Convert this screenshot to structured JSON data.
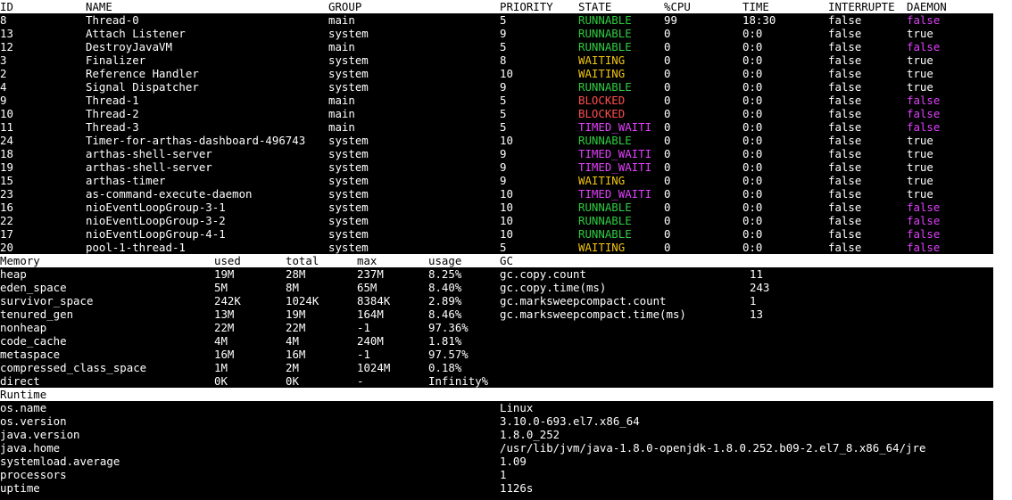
{
  "colors": {
    "background": "#000000",
    "header_bg": "#ffffff",
    "runnable": "#2ecc40",
    "waiting": "#f1c40f",
    "blocked": "#ff4d4d",
    "timed_waiting": "#e040fb",
    "daemon_false": "#e040fb"
  },
  "threads": {
    "headers": [
      "ID",
      "NAME",
      "GROUP",
      "PRIORITY",
      "STATE",
      "%CPU",
      "TIME",
      "INTERRUPTE",
      "DAEMON"
    ],
    "rows": [
      {
        "id": "8",
        "name": "Thread-0",
        "group": "main",
        "priority": "5",
        "state": "RUNNABLE",
        "cpu": "99",
        "time": "18:30",
        "interrupted": "false",
        "daemon": "false"
      },
      {
        "id": "13",
        "name": "Attach Listener",
        "group": "system",
        "priority": "9",
        "state": "RUNNABLE",
        "cpu": "0",
        "time": "0:0",
        "interrupted": "false",
        "daemon": "true"
      },
      {
        "id": "12",
        "name": "DestroyJavaVM",
        "group": "main",
        "priority": "5",
        "state": "RUNNABLE",
        "cpu": "0",
        "time": "0:0",
        "interrupted": "false",
        "daemon": "false"
      },
      {
        "id": "3",
        "name": "Finalizer",
        "group": "system",
        "priority": "8",
        "state": "WAITING",
        "cpu": "0",
        "time": "0:0",
        "interrupted": "false",
        "daemon": "true"
      },
      {
        "id": "2",
        "name": "Reference Handler",
        "group": "system",
        "priority": "10",
        "state": "WAITING",
        "cpu": "0",
        "time": "0:0",
        "interrupted": "false",
        "daemon": "true"
      },
      {
        "id": "4",
        "name": "Signal Dispatcher",
        "group": "system",
        "priority": "9",
        "state": "RUNNABLE",
        "cpu": "0",
        "time": "0:0",
        "interrupted": "false",
        "daemon": "true"
      },
      {
        "id": "9",
        "name": "Thread-1",
        "group": "main",
        "priority": "5",
        "state": "BLOCKED",
        "cpu": "0",
        "time": "0:0",
        "interrupted": "false",
        "daemon": "false"
      },
      {
        "id": "10",
        "name": "Thread-2",
        "group": "main",
        "priority": "5",
        "state": "BLOCKED",
        "cpu": "0",
        "time": "0:0",
        "interrupted": "false",
        "daemon": "false"
      },
      {
        "id": "11",
        "name": "Thread-3",
        "group": "main",
        "priority": "5",
        "state": "TIMED_WAITI",
        "cpu": "0",
        "time": "0:0",
        "interrupted": "false",
        "daemon": "false"
      },
      {
        "id": "24",
        "name": "Timer-for-arthas-dashboard-496743",
        "group": "system",
        "priority": "10",
        "state": "RUNNABLE",
        "cpu": "0",
        "time": "0:0",
        "interrupted": "false",
        "daemon": "true"
      },
      {
        "id": "18",
        "name": "arthas-shell-server",
        "group": "system",
        "priority": "9",
        "state": "TIMED_WAITI",
        "cpu": "0",
        "time": "0:0",
        "interrupted": "false",
        "daemon": "true"
      },
      {
        "id": "19",
        "name": "arthas-shell-server",
        "group": "system",
        "priority": "9",
        "state": "TIMED_WAITI",
        "cpu": "0",
        "time": "0:0",
        "interrupted": "false",
        "daemon": "true"
      },
      {
        "id": "15",
        "name": "arthas-timer",
        "group": "system",
        "priority": "9",
        "state": "WAITING",
        "cpu": "0",
        "time": "0:0",
        "interrupted": "false",
        "daemon": "true"
      },
      {
        "id": "23",
        "name": "as-command-execute-daemon",
        "group": "system",
        "priority": "10",
        "state": "TIMED_WAITI",
        "cpu": "0",
        "time": "0:0",
        "interrupted": "false",
        "daemon": "true"
      },
      {
        "id": "16",
        "name": "nioEventLoopGroup-3-1",
        "group": "system",
        "priority": "10",
        "state": "RUNNABLE",
        "cpu": "0",
        "time": "0:0",
        "interrupted": "false",
        "daemon": "false"
      },
      {
        "id": "22",
        "name": "nioEventLoopGroup-3-2",
        "group": "system",
        "priority": "10",
        "state": "RUNNABLE",
        "cpu": "0",
        "time": "0:0",
        "interrupted": "false",
        "daemon": "false"
      },
      {
        "id": "17",
        "name": "nioEventLoopGroup-4-1",
        "group": "system",
        "priority": "10",
        "state": "RUNNABLE",
        "cpu": "0",
        "time": "0:0",
        "interrupted": "false",
        "daemon": "false"
      },
      {
        "id": "20",
        "name": "pool-1-thread-1",
        "group": "system",
        "priority": "5",
        "state": "WAITING",
        "cpu": "0",
        "time": "0:0",
        "interrupted": "false",
        "daemon": "false"
      }
    ]
  },
  "memory": {
    "headers": [
      "Memory",
      "used",
      "total",
      "max",
      "usage",
      "GC"
    ],
    "rows": [
      {
        "name": "heap",
        "used": "19M",
        "total": "28M",
        "max": "237M",
        "usage": "8.25%",
        "gc_name": "gc.copy.count",
        "gc_value": "11"
      },
      {
        "name": "eden_space",
        "used": "5M",
        "total": "8M",
        "max": "65M",
        "usage": "8.40%",
        "gc_name": "gc.copy.time(ms)",
        "gc_value": "243"
      },
      {
        "name": "survivor_space",
        "used": "242K",
        "total": "1024K",
        "max": "8384K",
        "usage": "2.89%",
        "gc_name": "gc.marksweepcompact.count",
        "gc_value": "1"
      },
      {
        "name": "tenured_gen",
        "used": "13M",
        "total": "19M",
        "max": "164M",
        "usage": "8.46%",
        "gc_name": "gc.marksweepcompact.time(ms)",
        "gc_value": "13"
      },
      {
        "name": "nonheap",
        "used": "22M",
        "total": "22M",
        "max": "-1",
        "usage": "97.36%",
        "gc_name": "",
        "gc_value": ""
      },
      {
        "name": "code_cache",
        "used": "4M",
        "total": "4M",
        "max": "240M",
        "usage": "1.81%",
        "gc_name": "",
        "gc_value": ""
      },
      {
        "name": "metaspace",
        "used": "16M",
        "total": "16M",
        "max": "-1",
        "usage": "97.57%",
        "gc_name": "",
        "gc_value": ""
      },
      {
        "name": "compressed_class_space",
        "used": "1M",
        "total": "2M",
        "max": "1024M",
        "usage": "0.18%",
        "gc_name": "",
        "gc_value": ""
      },
      {
        "name": "direct",
        "used": "0K",
        "total": "0K",
        "max": "-",
        "usage": "Infinity%",
        "gc_name": "",
        "gc_value": ""
      }
    ]
  },
  "runtime": {
    "header": "Runtime",
    "rows": [
      {
        "key": "os.name",
        "value": "Linux"
      },
      {
        "key": "os.version",
        "value": "3.10.0-693.el7.x86_64"
      },
      {
        "key": "java.version",
        "value": "1.8.0_252"
      },
      {
        "key": "java.home",
        "value": "/usr/lib/jvm/java-1.8.0-openjdk-1.8.0.252.b09-2.el7_8.x86_64/jre"
      },
      {
        "key": "systemload.average",
        "value": "1.09"
      },
      {
        "key": "processors",
        "value": "1"
      },
      {
        "key": "uptime",
        "value": "1126s"
      }
    ]
  }
}
